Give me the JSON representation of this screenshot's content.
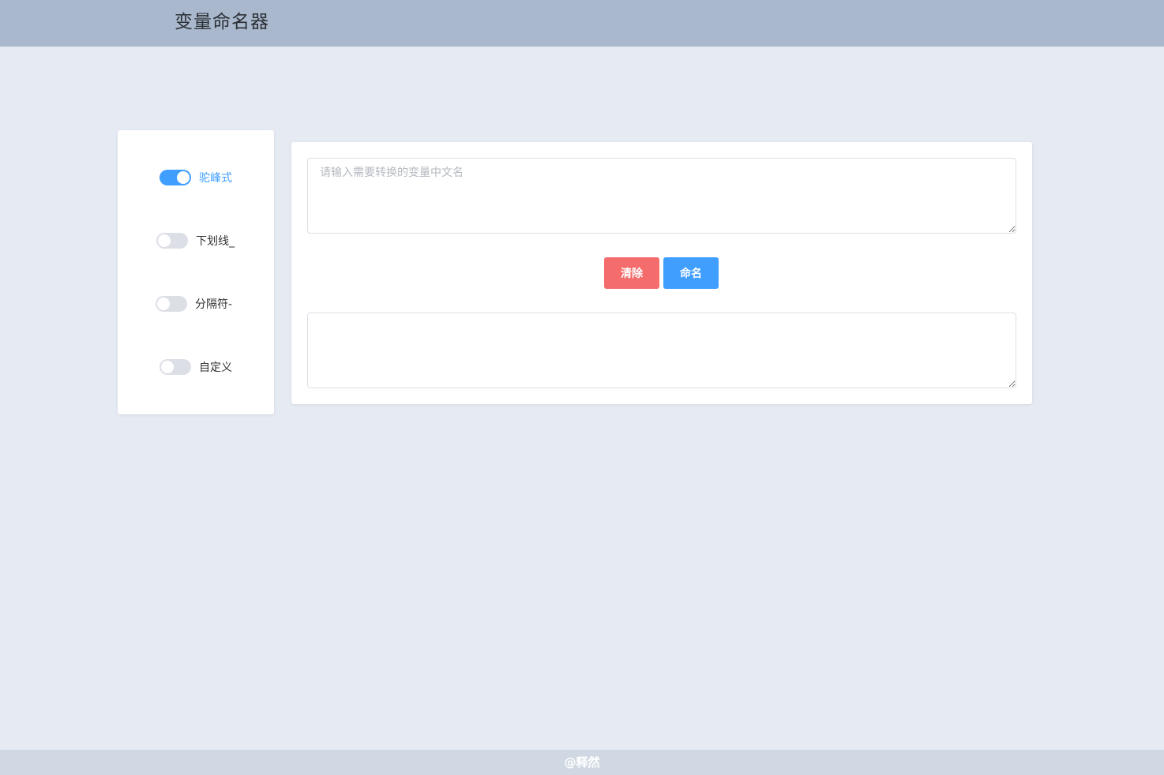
{
  "header": {
    "title": "变量命名器"
  },
  "options": [
    {
      "label": "驼峰式",
      "enabled": true
    },
    {
      "label": "下划线_",
      "enabled": false
    },
    {
      "label": "分隔符-",
      "enabled": false
    },
    {
      "label": "自定义",
      "enabled": false
    }
  ],
  "input": {
    "value": "",
    "placeholder": "请输入需要转换的变量中文名"
  },
  "actions": {
    "clear_label": "清除",
    "name_label": "命名"
  },
  "output": {
    "value": ""
  },
  "footer": {
    "text": "@释然"
  },
  "colors": {
    "header_bg": "#a9b8cc",
    "page_bg": "#e5eaf3",
    "accent": "#409eff",
    "danger": "#f56c6c",
    "switch_off": "#dcdfe6"
  }
}
